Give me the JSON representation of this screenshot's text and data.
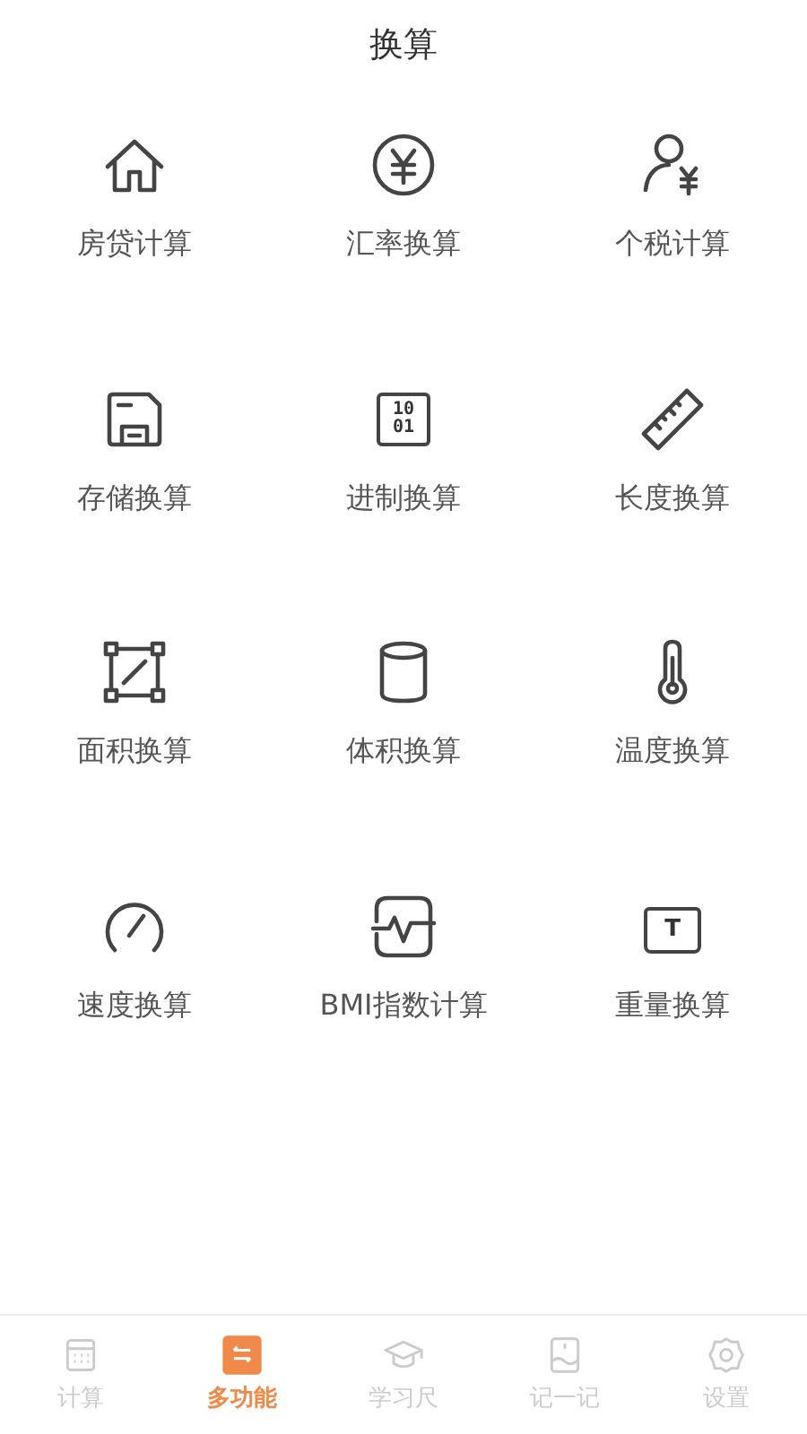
{
  "title": "换算",
  "tools": [
    {
      "kind": "house",
      "label": "房贷计算"
    },
    {
      "kind": "yen",
      "label": "汇率换算"
    },
    {
      "kind": "person-yen",
      "label": "个税计算"
    },
    {
      "kind": "floppy",
      "label": "存储换算"
    },
    {
      "kind": "binary",
      "label": "进制换算",
      "digits": [
        "10",
        "01"
      ]
    },
    {
      "kind": "ruler",
      "label": "长度换算"
    },
    {
      "kind": "area",
      "label": "面积换算"
    },
    {
      "kind": "cylinder",
      "label": "体积换算"
    },
    {
      "kind": "thermometer",
      "label": "温度换算"
    },
    {
      "kind": "gauge",
      "label": "速度换算"
    },
    {
      "kind": "pulse",
      "label": "BMI指数计算"
    },
    {
      "kind": "weight",
      "label": "重量换算",
      "glyph": "T"
    }
  ],
  "tabs": [
    {
      "kind": "calculator",
      "label": "计算",
      "selected": false
    },
    {
      "kind": "swap",
      "label": "多功能",
      "selected": true
    },
    {
      "kind": "cap",
      "label": "学习尺",
      "selected": false
    },
    {
      "kind": "note",
      "label": "记一记",
      "selected": false
    },
    {
      "kind": "gear",
      "label": "设置",
      "selected": false
    }
  ]
}
